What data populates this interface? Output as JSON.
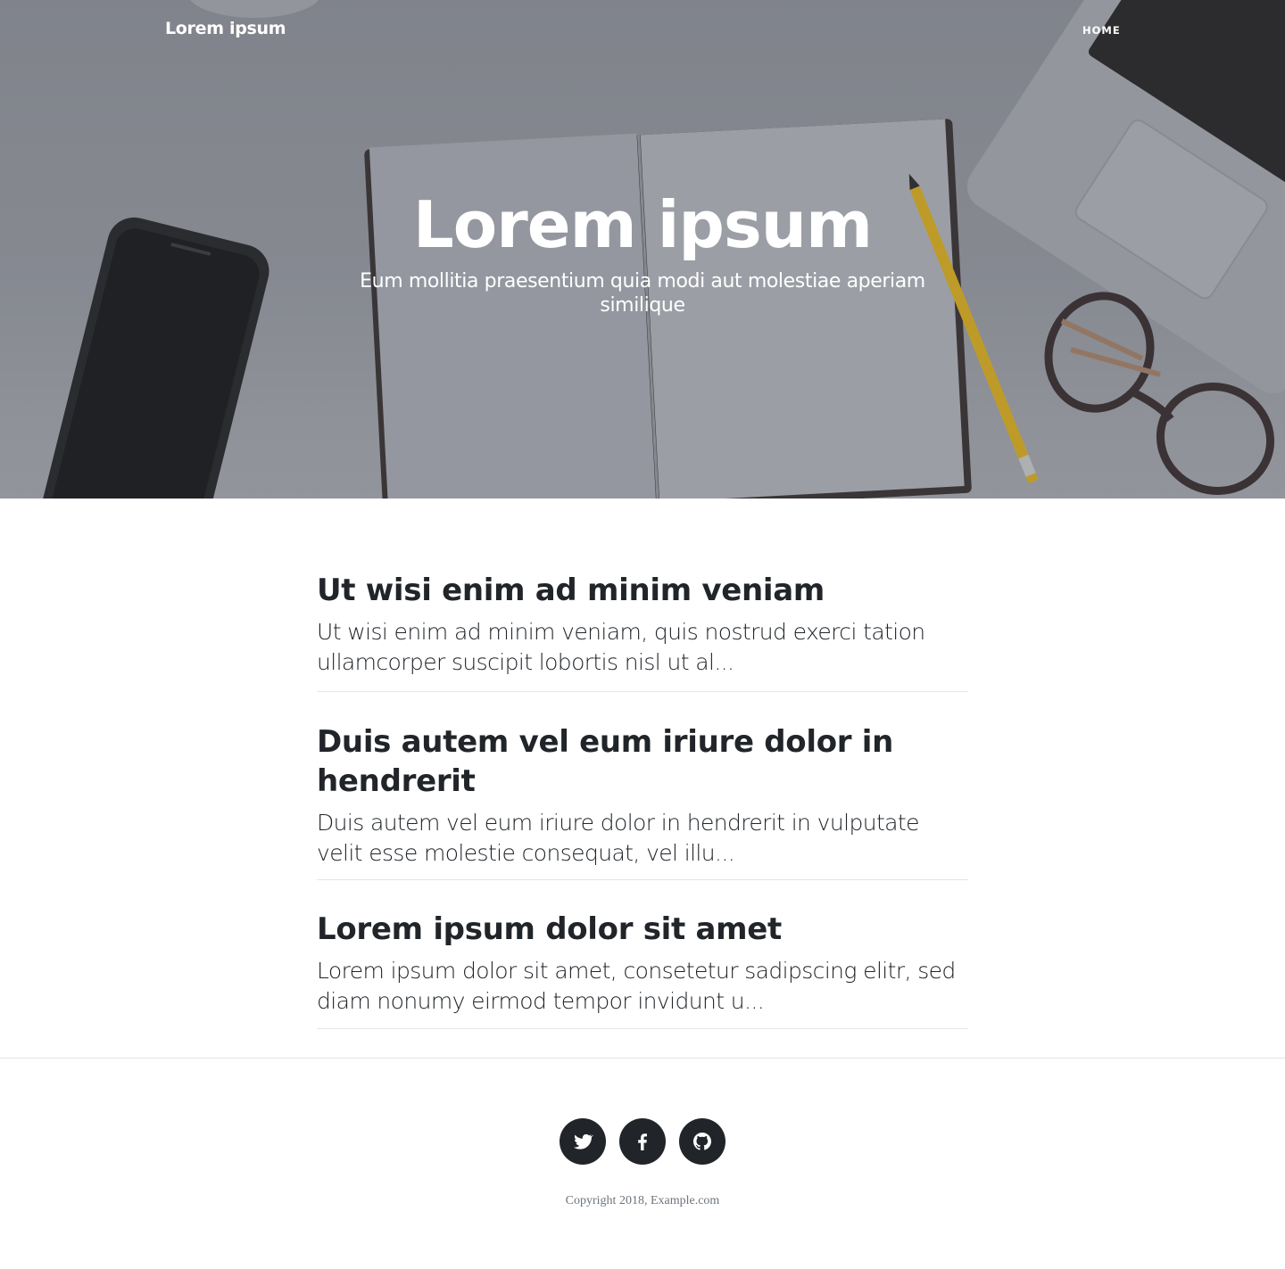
{
  "navbar": {
    "brand": "Lorem ipsum",
    "links": [
      {
        "label": "HOME"
      }
    ]
  },
  "hero": {
    "title": "Lorem ipsum",
    "subtitle": "Eum mollitia praesentium quia modi aut molestiae aperiam similique"
  },
  "posts": [
    {
      "title": "Ut wisi enim ad minim veniam",
      "excerpt": "Ut wisi enim ad minim veniam, quis nostrud exerci tation ullamcorper suscipit lobortis nisl ut al..."
    },
    {
      "title": "Duis autem vel eum iriure dolor in hendrerit",
      "excerpt": "Duis autem vel eum iriure dolor in hendrerit in vulputate velit esse molestie consequat, vel illu..."
    },
    {
      "title": "Lorem ipsum dolor sit amet",
      "excerpt": "Lorem ipsum dolor sit amet, consetetur sadipscing elitr, sed diam nonumy eirmod tempor invidunt u..."
    }
  ],
  "footer": {
    "social": [
      {
        "icon": "twitter-icon"
      },
      {
        "icon": "facebook-icon"
      },
      {
        "icon": "github-icon"
      }
    ],
    "copyright": "Copyright 2018, Example.com"
  },
  "colors": {
    "text": "#212529",
    "muted": "#6c757d",
    "hero_overlay": "#868891",
    "divider": "#e6e6e6"
  }
}
